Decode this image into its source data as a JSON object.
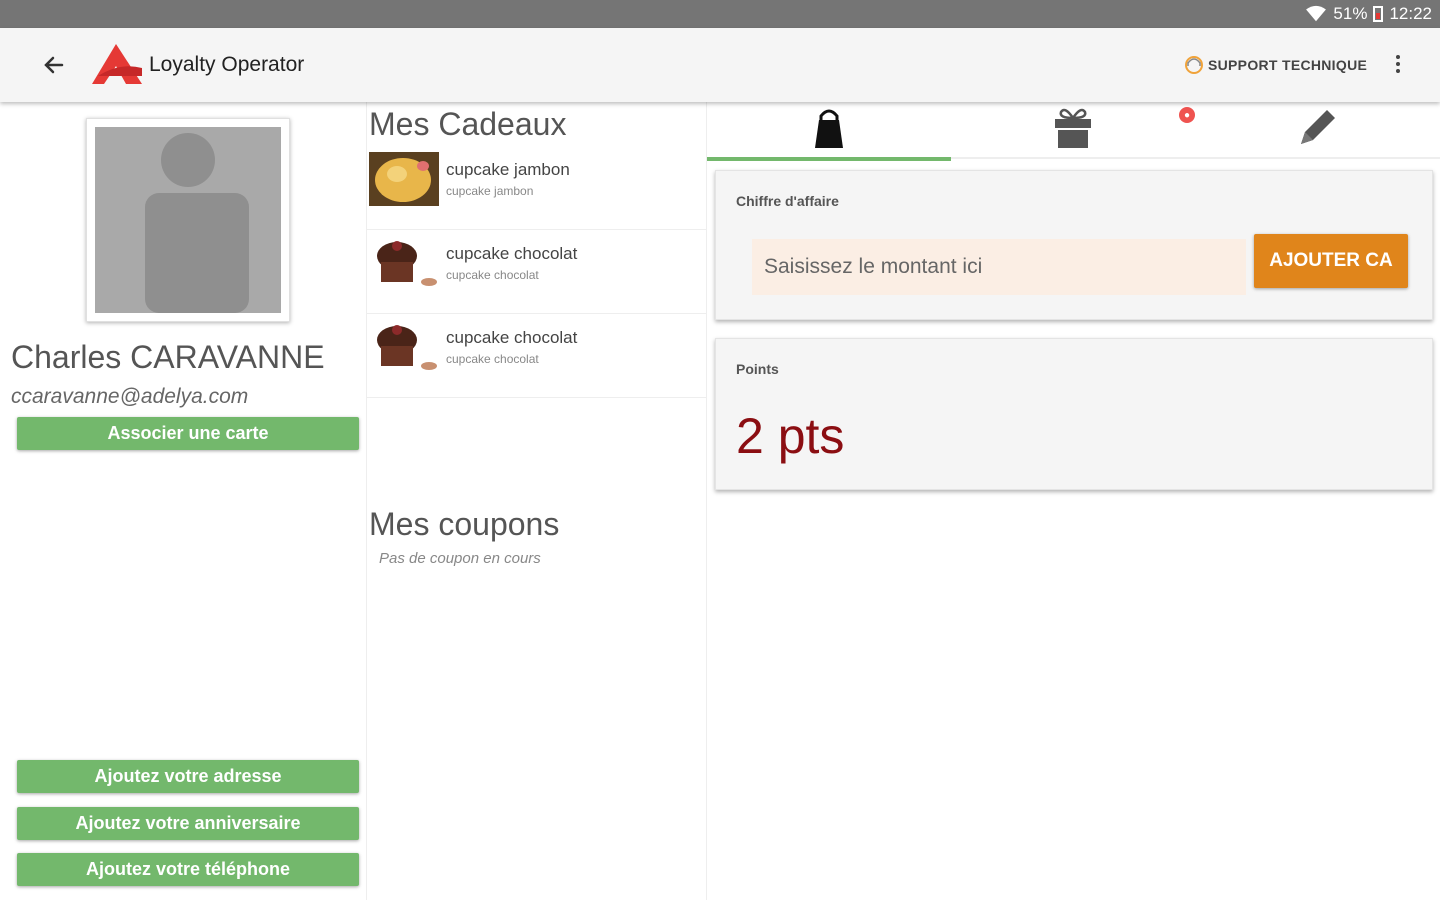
{
  "status_bar": {
    "battery": "51%",
    "time": "12:22"
  },
  "app_bar": {
    "title": "Loyalty Operator",
    "support_label": "SUPPORT TECHNIQUE",
    "icons": [
      "back-arrow-icon",
      "app-logo",
      "support-icon",
      "more-vert-icon"
    ]
  },
  "profile": {
    "name": "Charles CARAVANNE",
    "email": "ccaravanne@adelya.com",
    "associate_card": "Associer une carte",
    "add_address": "Ajoutez votre adresse",
    "add_birthday": "Ajoutez votre anniversaire",
    "add_phone": "Ajoutez votre téléphone"
  },
  "gifts": {
    "title": "Mes Cadeaux",
    "items": [
      {
        "name": "cupcake jambon",
        "description": "cupcake jambon"
      },
      {
        "name": "cupcake chocolat",
        "description": "cupcake chocolat"
      },
      {
        "name": "cupcake chocolat",
        "description": "cupcake chocolat"
      }
    ]
  },
  "coupons": {
    "title": "Mes coupons",
    "empty": "Pas de coupon en cours"
  },
  "tabs": [
    "shopping-bag-icon",
    "gift-icon",
    "notification-badge",
    "pencil-icon"
  ],
  "revenue_card": {
    "label": "Chiffre d'affaire",
    "placeholder": "Saisissez le montant ici",
    "button": "AJOUTER CA"
  },
  "points_card": {
    "label": "Points",
    "value": "2 pts"
  },
  "colors": {
    "green": "#73b86c",
    "orange": "#e0851b",
    "points_red": "#8b0e12",
    "logo_red": "#e53935"
  }
}
